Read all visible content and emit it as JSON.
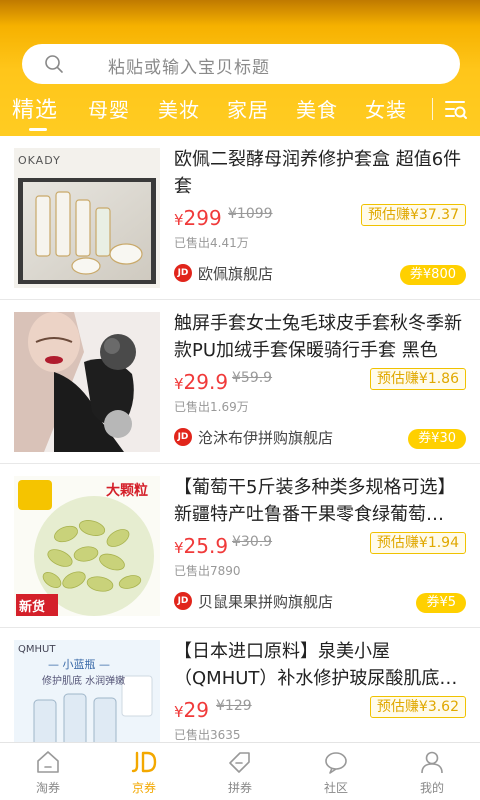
{
  "search": {
    "placeholder": "粘贴或输入宝贝标题"
  },
  "tabs": [
    {
      "label": "精选",
      "active": true
    },
    {
      "label": "母婴"
    },
    {
      "label": "美妆"
    },
    {
      "label": "家居"
    },
    {
      "label": "美食"
    },
    {
      "label": "女装"
    }
  ],
  "colors": {
    "brand": "#ffc61a",
    "price": "#f03a3a",
    "coupon": "#ffd000",
    "jd_red": "#e1251b"
  },
  "products": [
    {
      "title": "欧佩二裂酵母润养修护套盒 超值6件套",
      "yen": "¥",
      "price": "299",
      "orig_price": "¥1099",
      "earn": "预估赚¥37.37",
      "sold": "已售出4.41万",
      "shop_badge": "JD",
      "shop": "欧佩旗舰店",
      "coupon": "券¥800",
      "thumb_brand": "OKADY"
    },
    {
      "title": "触屏手套女士兔毛球皮手套秋冬季新款PU加绒手套保暖骑行手套 黑色",
      "yen": "¥",
      "price": "29.9",
      "orig_price": "¥59.9",
      "earn": "预估赚¥1.86",
      "sold": "已售出1.69万",
      "shop_badge": "JD",
      "shop": "沧沐布伊拼购旗舰店",
      "coupon": "券¥30"
    },
    {
      "title": "【葡萄干5斤装多种类多规格可选】新疆特产吐鲁番干果零食绿葡萄…",
      "yen": "¥",
      "price": "25.9",
      "orig_price": "¥30.9",
      "earn": "预估赚¥1.94",
      "sold": "已售出7890",
      "shop_badge": "JD",
      "shop": "贝鼠果果拼购旗舰店",
      "coupon": "券¥5",
      "thumb_tag_big": "大颗粒",
      "thumb_tag_new": "新货"
    },
    {
      "title": "【日本进口原料】泉美小屋（QMHUT）补水修护玻尿酸肌底…",
      "yen": "¥",
      "price": "29",
      "orig_price": "¥129",
      "earn": "预估赚¥3.62",
      "sold": "已售出3635",
      "thumb_brand": "QMHUT",
      "thumb_line1": "— 小蓝瓶 —",
      "thumb_line2": "修护肌底 水润弹嫩"
    }
  ],
  "nav": [
    {
      "label": "淘券",
      "icon": "home-icon"
    },
    {
      "label": "京券",
      "icon": "jd-icon",
      "active": true
    },
    {
      "label": "拼券",
      "icon": "tag-icon"
    },
    {
      "label": "社区",
      "icon": "chat-icon"
    },
    {
      "label": "我的",
      "icon": "user-icon"
    }
  ]
}
